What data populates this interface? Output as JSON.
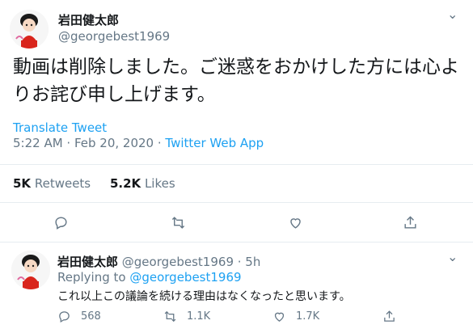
{
  "tweet": {
    "author_name": "岩田健太郎",
    "author_handle": "@georgebest1969",
    "more_glyph": "⌄",
    "text": "動画は削除しました。ご迷惑をおかけした方には心よりお詫び申し上げます。",
    "translate_label": "Translate Tweet",
    "timestamp": "5:22 AM · Feb 20, 2020 · ",
    "source_app": "Twitter Web App",
    "retweets_count": "5K",
    "retweets_label": "Retweets",
    "likes_count": "5.2K",
    "likes_label": "Likes",
    "actions": {
      "reply_icon": "reply-icon",
      "retweet_icon": "retweet-icon",
      "like_icon": "heart-icon",
      "share_icon": "share-icon"
    }
  },
  "reply": {
    "author_name": "岩田健太郎",
    "handle_time": " @georgebest1969 · 5h",
    "replying_prefix": "Replying to ",
    "replying_to": "@georgebest1969",
    "text": "これ以上この議論を続ける理由はなくなったと思います。",
    "reply_count": "568",
    "retweet_count": "1.1K",
    "like_count": "1.7K"
  },
  "colors": {
    "accent": "#1da1f2",
    "secondary_text": "#657786",
    "primary_text": "#14171a",
    "divider": "#e6ecf0"
  }
}
